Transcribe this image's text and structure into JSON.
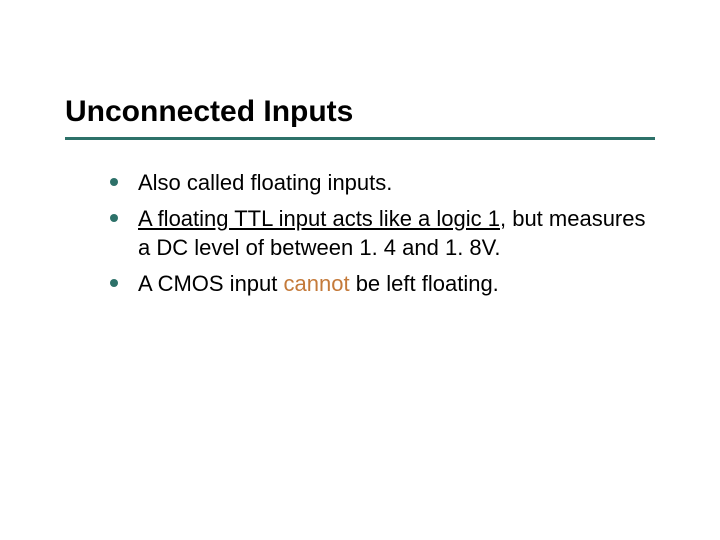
{
  "title": "Unconnected Inputs",
  "bullets": {
    "b0": "Also called floating inputs.",
    "b1_underlined": "A floating TTL input acts like a logic 1",
    "b1_rest": ", but measures a DC level of between 1. 4 and 1. 8V.",
    "b2_pre": "A CMOS input ",
    "b2_highlight": "cannot",
    "b2_post": " be left floating."
  },
  "colors": {
    "accent": "#2d7169",
    "highlight": "#c47a3a"
  }
}
